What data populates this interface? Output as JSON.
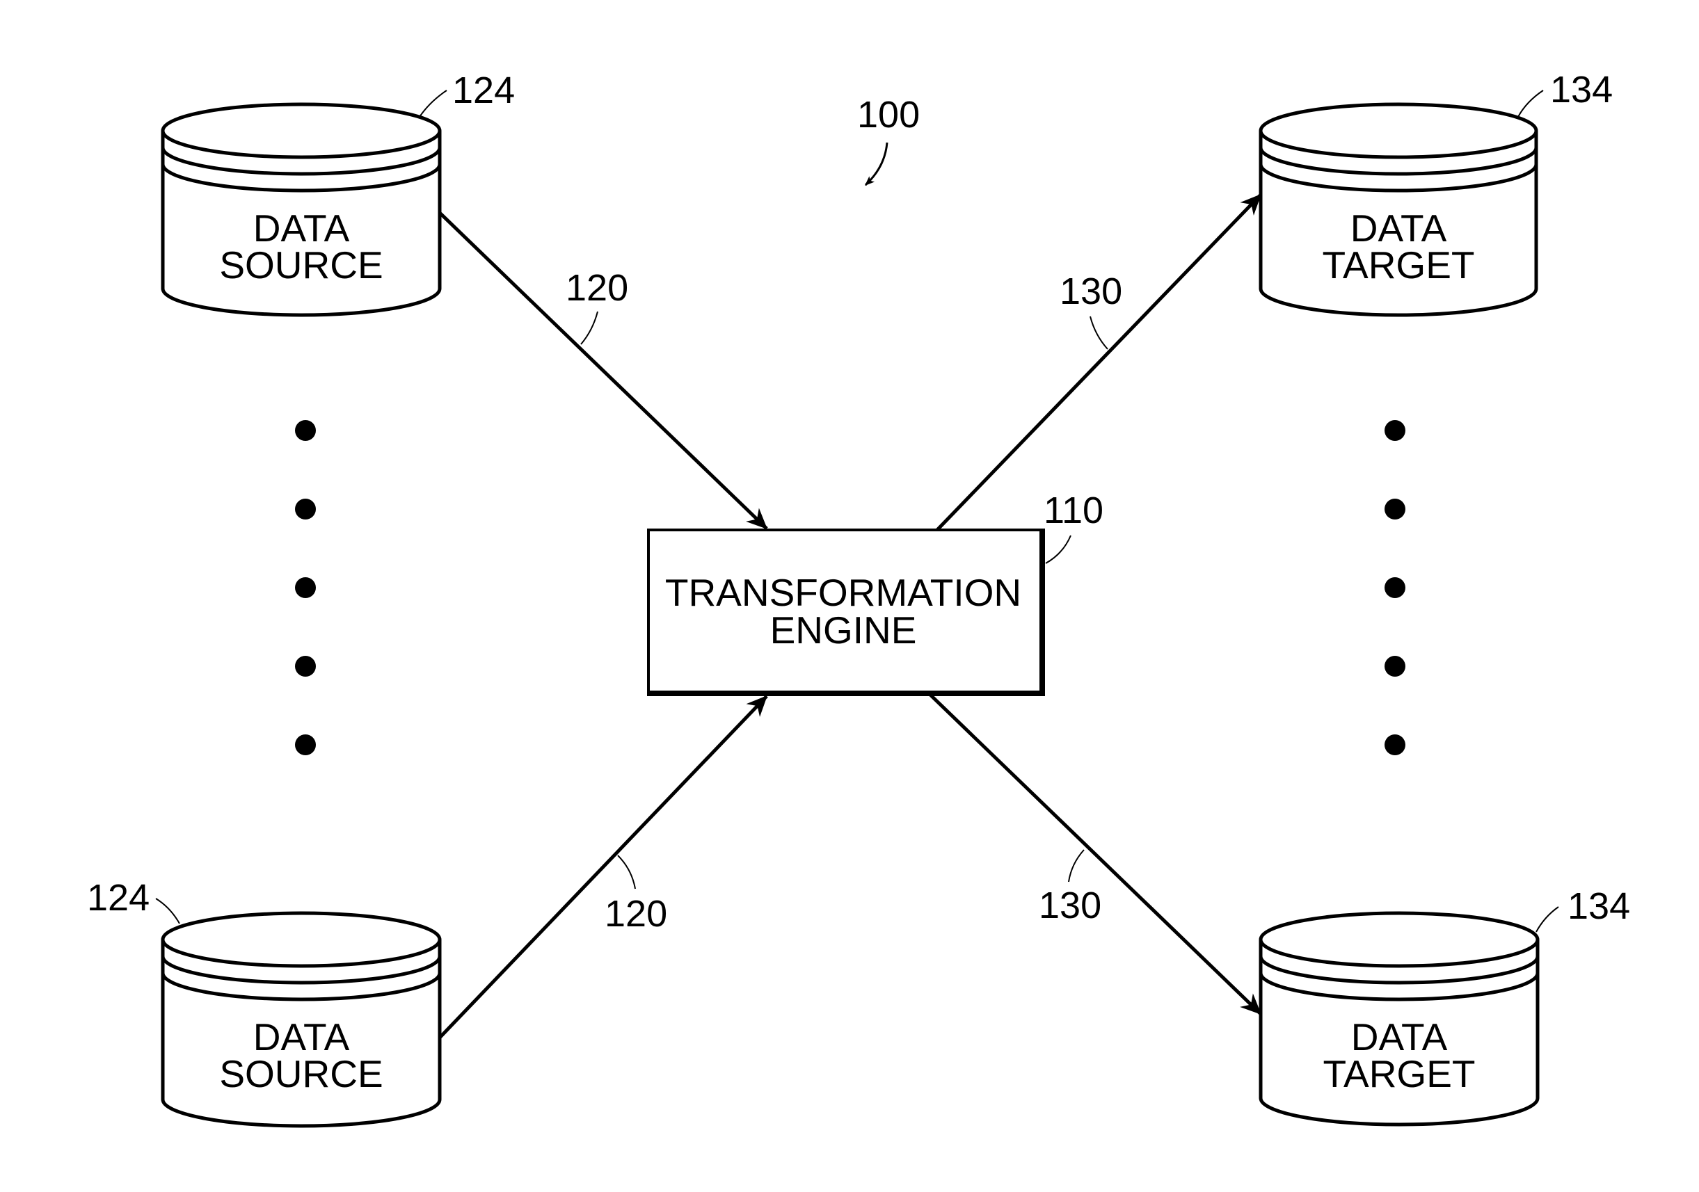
{
  "figure": {
    "figure_ref": "100",
    "engine": {
      "ref": "110",
      "label_lines": [
        "TRANSFORMATION",
        "ENGINE"
      ]
    },
    "sources": [
      {
        "ref": "124",
        "label_lines": [
          "DATA",
          "SOURCE"
        ]
      },
      {
        "ref": "124",
        "label_lines": [
          "DATA",
          "SOURCE"
        ]
      }
    ],
    "targets": [
      {
        "ref": "134",
        "label_lines": [
          "DATA",
          "TARGET"
        ]
      },
      {
        "ref": "134",
        "label_lines": [
          "DATA",
          "TARGET"
        ]
      }
    ],
    "connections": [
      {
        "ref": "120",
        "from": "source-1",
        "to": "engine"
      },
      {
        "ref": "120",
        "from": "source-2",
        "to": "engine"
      },
      {
        "ref": "130",
        "from": "engine",
        "to": "target-1"
      },
      {
        "ref": "130",
        "from": "engine",
        "to": "target-2"
      }
    ],
    "ellipsis_dot_count": 5
  }
}
